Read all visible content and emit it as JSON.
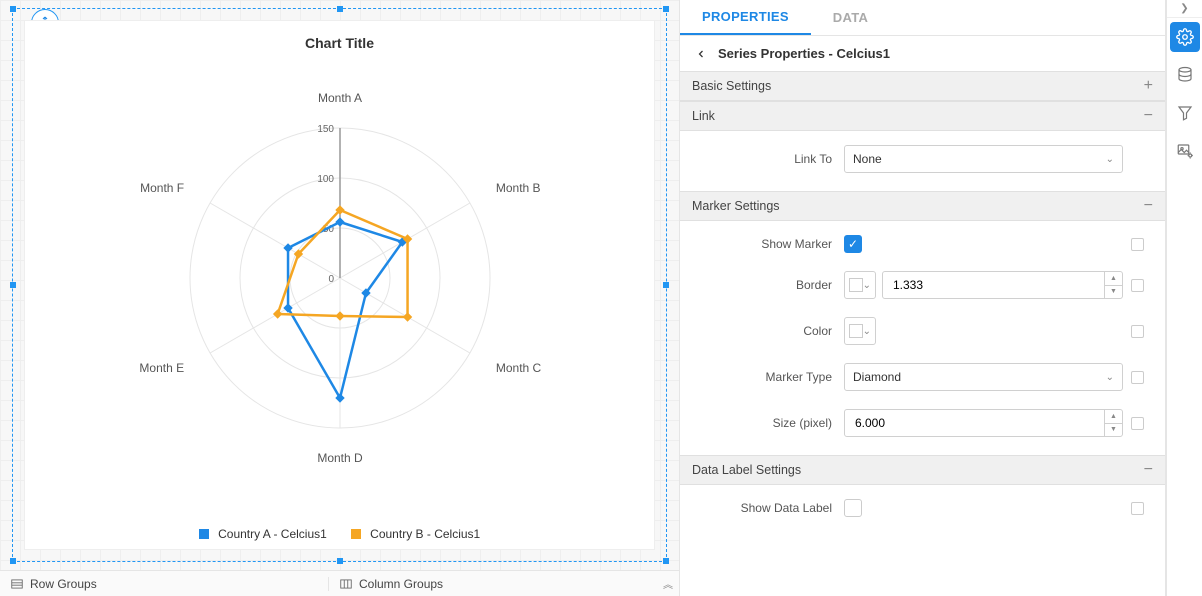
{
  "colors": {
    "seriesA": "#1e88e5",
    "seriesB": "#f5a623"
  },
  "canvas": {
    "chart_title": "Chart Title",
    "legend": {
      "a": "Country A - Celcius1",
      "b": "Country B - Celcius1"
    },
    "groups": {
      "row": "Row Groups",
      "column": "Column Groups"
    }
  },
  "chart_data": {
    "type": "radar",
    "title": "Chart Title",
    "categories": [
      "Month A",
      "Month B",
      "Month C",
      "Month D",
      "Month E",
      "Month F"
    ],
    "rlim": [
      0,
      150
    ],
    "ticks": [
      0,
      50,
      100,
      150
    ],
    "series": [
      {
        "name": "Country A - Celcius1",
        "color": "#1e88e5",
        "values": [
          56,
          72,
          30,
          120,
          60,
          60
        ]
      },
      {
        "name": "Country B - Celcius1",
        "color": "#f5a623",
        "values": [
          68,
          78,
          78,
          38,
          72,
          48
        ]
      }
    ]
  },
  "panel": {
    "tabs": {
      "properties": "PROPERTIES",
      "data": "DATA"
    },
    "breadcrumb": "Series Properties - Celcius1",
    "sections": {
      "basic": {
        "title": "Basic Settings",
        "expanded": false
      },
      "link": {
        "title": "Link",
        "expanded": true,
        "link_to_label": "Link To",
        "link_to_value": "None"
      },
      "marker": {
        "title": "Marker Settings",
        "expanded": true,
        "show_marker_label": "Show Marker",
        "show_marker_value": true,
        "border_label": "Border",
        "border_value": "1.333",
        "color_label": "Color",
        "marker_type_label": "Marker Type",
        "marker_type_value": "Diamond",
        "size_label": "Size (pixel)",
        "size_value": "6.000"
      },
      "data_label": {
        "title": "Data Label Settings",
        "expanded": true,
        "show_data_label_label": "Show Data Label",
        "show_data_label_value": false
      }
    }
  }
}
